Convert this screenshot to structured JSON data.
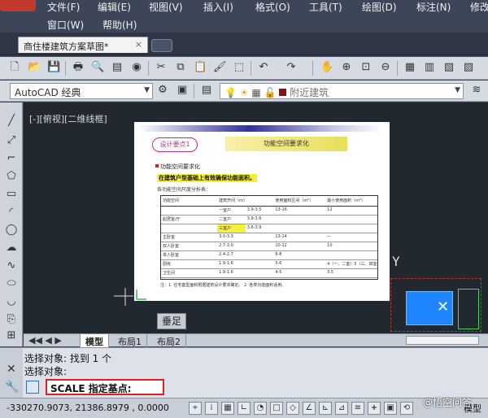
{
  "menu": {
    "row1": [
      "文件(F)",
      "编辑(E)",
      "视图(V)",
      "插入(I)",
      "格式(O)",
      "工具(T)",
      "绘图(D)",
      "标注(N)",
      "修改"
    ],
    "row2": [
      "窗口(W)",
      "帮助(H)"
    ]
  },
  "document_tab": {
    "title": "商住楼建筑方案草图*",
    "close": "×"
  },
  "toolbar": {
    "workspace": "AutoCAD 经典",
    "layer": "附近建筑"
  },
  "viewport": {
    "label": "[-][俯视][二维线框]"
  },
  "drawing_sheet": {
    "tag": "设计要点1",
    "header": "功能空间要求化",
    "title": "功能空间要求化",
    "highlight": "在建筑户型基础上有效确保功能面积。",
    "subtitle": "各功能空间尺度分析表：",
    "table_headers": [
      "功能空间",
      "建筑开间（m）",
      "使用面积区间（m²）",
      "最小使用面积（m²）"
    ],
    "table_rows": [
      [
        "",
        "一室户",
        "3.9-3.5",
        "13-16",
        "12"
      ],
      [
        "起居室/厅",
        "二室户",
        "3.9-3.6",
        "",
        ""
      ],
      [
        "",
        "三室户",
        "3.6-3.9",
        "",
        ""
      ],
      [
        "主卧室",
        "3.0-3.3",
        "",
        "13-14",
        "—"
      ],
      [
        "双人卧室",
        "2.7-3.0",
        "",
        "10-12",
        "10"
      ],
      [
        "单人卧室",
        "2.4-2.7",
        "",
        "6-8",
        ""
      ],
      [
        "厨房",
        "1.9-1.6",
        "",
        "5-6",
        "4（一、二室）5（三、四室）"
      ],
      [
        "卫生间",
        "1.9-1.6",
        "",
        "4-5",
        "3.5"
      ]
    ],
    "footer": "注：1. 住宅套型面积根据建筑设计要求确定。 2. 各类功能面积适用。"
  },
  "canvas": {
    "y_axis_label": "Y"
  },
  "tooltip": "垂足",
  "layout_tabs": [
    "模型",
    "布局1",
    "布局2"
  ],
  "command": {
    "history": [
      "选择对象: 找到 1 个",
      "选择对象:"
    ],
    "input": "SCALE 指定基点:"
  },
  "status": {
    "coordinates": "-330270.9073, 21386.8979 , 0.0000",
    "model_label": "模型"
  },
  "watermark": "@悟空问答"
}
